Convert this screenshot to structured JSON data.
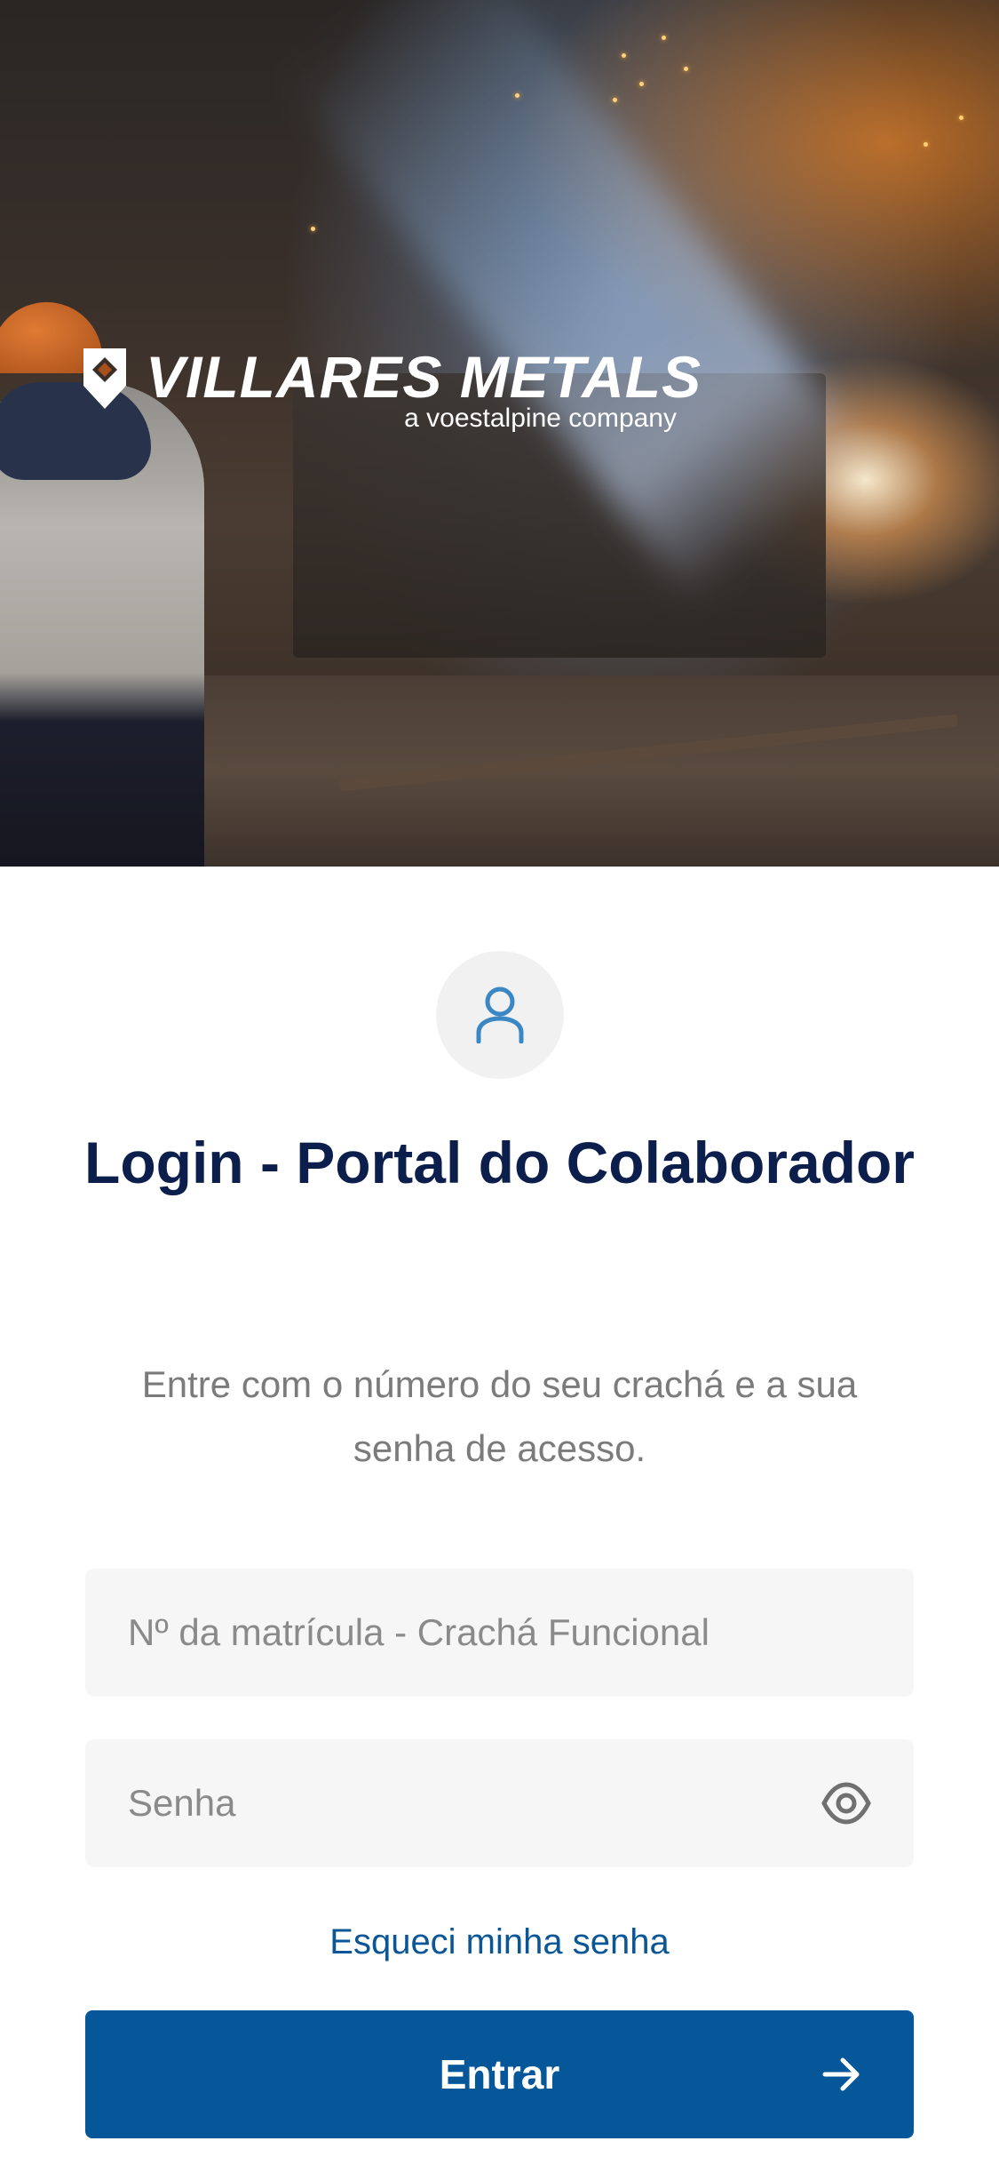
{
  "hero": {
    "logo": {
      "brand": "VILLARES METALS",
      "tagline": "a voestalpine company"
    }
  },
  "login": {
    "avatar_icon": "user-icon",
    "title": "Login - Portal do Colaborador",
    "subtitle": "Entre com o número do seu crachá e a sua senha de acesso.",
    "badge_field": {
      "placeholder": "Nº da matrícula - Crachá Funcional",
      "value": ""
    },
    "password_field": {
      "placeholder": "Senha",
      "value": "",
      "toggle_icon": "eye-icon"
    },
    "forgot_link": "Esqueci minha senha",
    "submit": {
      "label": "Entrar",
      "icon": "arrow-right-icon"
    }
  },
  "colors": {
    "primary": "#06579a",
    "title": "#0c1f4c",
    "subtitle": "#7b7b7b",
    "field_bg": "#f6f6f6",
    "avatar_bg": "#f1f1f1",
    "icon_accent": "#3b87c4"
  }
}
